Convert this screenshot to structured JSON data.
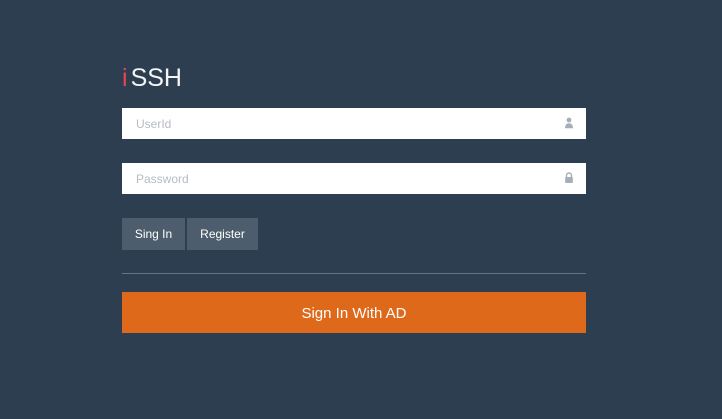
{
  "brand": {
    "mark": "i",
    "title": "SSH",
    "mark_color": "#e8434f"
  },
  "fields": {
    "user_id": {
      "placeholder": "UserId",
      "value": "",
      "icon": "user-icon"
    },
    "password": {
      "placeholder": "Password",
      "value": "",
      "icon": "lock-icon"
    }
  },
  "actions": {
    "sign_in_label": "Sing In",
    "register_label": "Register",
    "ad_sign_in_label": "Sign In With AD"
  },
  "colors": {
    "background": "#2d3e50",
    "secondary_button": "#4d5d6d",
    "accent": "#df691a"
  }
}
